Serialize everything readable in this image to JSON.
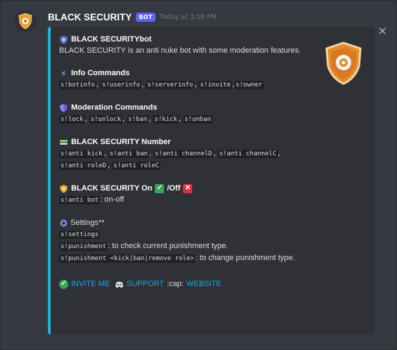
{
  "message": {
    "username": "BLACK SECURITY",
    "bot_tag": "BOT",
    "timestamp": "Today at 3:18 PM"
  },
  "close_label": "×",
  "embed": {
    "accent_color": "#1fb5d8",
    "title": "BLACK SECURITYbot",
    "description": "BLACK SECURITY is an anti nuke bot with some moderation features.",
    "sections": {
      "info": {
        "title": "Info Commands",
        "commands": [
          "s!botinfo",
          "s!userinfo",
          "s!serverinfo",
          "s!invite",
          "s!owner"
        ]
      },
      "moderation": {
        "title": "Moderation Commands",
        "commands": [
          "s!lock",
          "s!unlock",
          "s!ban",
          "s!kick",
          "s!unban"
        ]
      },
      "number": {
        "title": "BLACK SECURITY Number",
        "commands": [
          "s!anti kick",
          "s!anti ban",
          "s!anti channelD",
          "s!anti channelC",
          "s!anti roleD",
          "s!anti roleC"
        ]
      },
      "onoff": {
        "title_prefix": "BLACK SECURITY On",
        "title_mid": "/Off",
        "command": "s!anti bot",
        "suffix": ": on-off"
      },
      "settings": {
        "title": "Settings**",
        "command1": "s!settings",
        "command2": "s!punishment",
        "text2": ": to check current punishment type.",
        "command3": "s!punishment <kick|ban|remove role>",
        "text3": ": to change punishment type."
      }
    },
    "links": {
      "invite": "INVITE ME",
      "support": "SUPPORT",
      "cap": ":cap:",
      "website": "WEBSITE"
    }
  },
  "icons": [
    "shield-logo",
    "shield-icon",
    "info-icon",
    "moderation-shield-icon",
    "numbers-icon",
    "on-shield-icon",
    "check-icon",
    "cross-icon",
    "gear-icon",
    "discord-icon"
  ]
}
